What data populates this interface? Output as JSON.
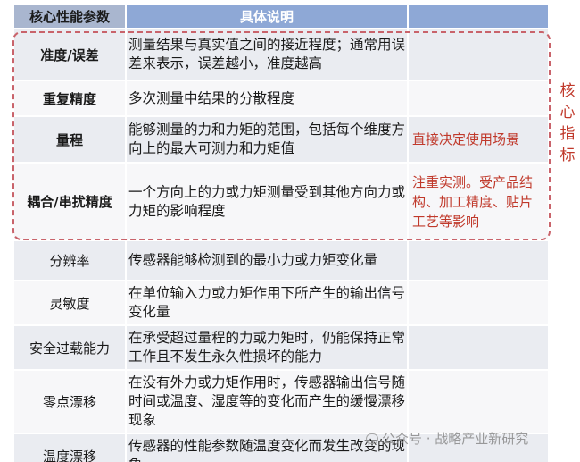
{
  "header": {
    "param": "核心性能参数",
    "desc": "具体说明",
    "note": ""
  },
  "rows": [
    {
      "param": "准度/误差",
      "desc": "测量结果与真实值之间的接近程度；通常用误差来表示，误差越小，准度越高",
      "note": ""
    },
    {
      "param": "重复精度",
      "desc": "多次测量中结果的分散程度",
      "note": ""
    },
    {
      "param": "量程",
      "desc": "能够测量的力和力矩的范围，包括每个维度方向上的最大可测力和力矩值",
      "note": "直接决定使用场景"
    },
    {
      "param": "耦合/串扰精度",
      "desc": "一个方向上的力或力矩测量受到其他方向力或力矩的影响程度",
      "note": "注重实测。受产品结构、加工精度、贴片工艺等影响"
    },
    {
      "param": "分辨率",
      "desc": "传感器能够检测到的最小力或力矩变化量",
      "note": ""
    },
    {
      "param": "灵敏度",
      "desc": "在单位输入力或力矩作用下所产生的输出信号变化量",
      "note": ""
    },
    {
      "param": "安全过载能力",
      "desc": "在承受超过量程的力或力矩时，仍能保持正常工作且不发生永久性损坏的能力",
      "note": ""
    },
    {
      "param": "零点漂移",
      "desc": "在没有外力或力矩作用时，传感器输出信号随时间或温度、湿度等的变化而产生的缓慢漂移现象",
      "note": ""
    },
    {
      "param": "温度漂移",
      "desc": "传感器的性能参数随温度变化而发生改变的现象",
      "note": ""
    }
  ],
  "side_label": "核心指标",
  "watermark": "公众号 · 战略产业新研究",
  "colors": {
    "accent_red": "#c0392b",
    "header_blue": "#8ea8d6",
    "dashed": "#c9636b"
  }
}
